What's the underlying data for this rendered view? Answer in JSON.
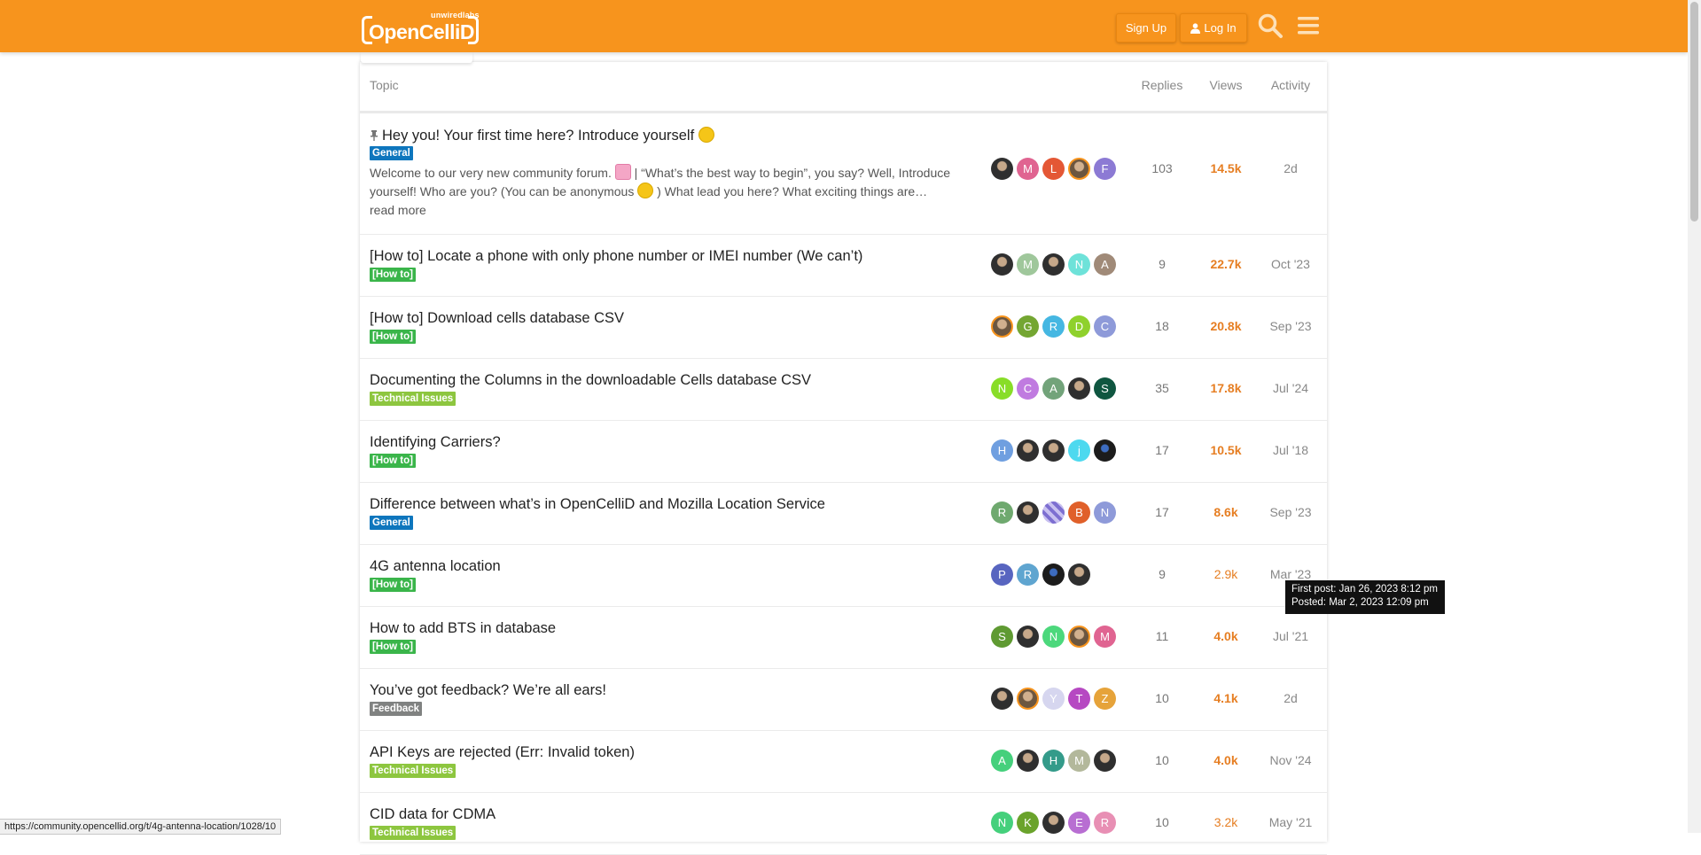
{
  "header": {
    "brand_small": "unwiredlabs",
    "brand": "OpenCelliD",
    "signup_label": "Sign Up",
    "login_label": "Log In",
    "bg": "#f7941d"
  },
  "table": {
    "col_topic": "Topic",
    "col_replies": "Replies",
    "col_views": "Views",
    "col_activity": "Activity"
  },
  "topics": [
    {
      "title": "Hey you! Your first time here? Introduce yourself",
      "pinned": true,
      "category": "General",
      "category_color": "#0e76bd",
      "excerpt_1": "Welcome to our very new community forum.",
      "excerpt_2": "| “What’s the best way to begin”, you say? Well, Introduce yourself! Who are you? (You can be anonymous",
      "excerpt_3": ") What lead you here? What exciting things are…",
      "read_more": "read more",
      "posters": [
        {
          "letter": "",
          "color": "",
          "kind": "photo"
        },
        {
          "letter": "M",
          "color": "#e06491"
        },
        {
          "letter": "L",
          "color": "#e45735"
        },
        {
          "letter": "",
          "color": "",
          "kind": "photo alt"
        },
        {
          "letter": "F",
          "color": "#8c7ad4"
        }
      ],
      "replies": "103",
      "views": "14.5k",
      "activity": "2d"
    },
    {
      "title": "[How to] Locate a phone with only phone number or IMEI number (We can’t)",
      "category": "[How to]",
      "category_color": "#3ab54a",
      "posters": [
        {
          "letter": "",
          "kind": "photo"
        },
        {
          "letter": "M",
          "color": "#9fc79b"
        },
        {
          "letter": "",
          "kind": "photo"
        },
        {
          "letter": "N",
          "color": "#6ee2d9"
        },
        {
          "letter": "A",
          "color": "#a08a78"
        }
      ],
      "replies": "9",
      "views": "22.7k",
      "activity": "Oct '23"
    },
    {
      "title": "[How to] Download cells database CSV",
      "category": "[How to]",
      "category_color": "#3ab54a",
      "posters": [
        {
          "letter": "",
          "kind": "photo alt"
        },
        {
          "letter": "G",
          "color": "#74a632"
        },
        {
          "letter": "R",
          "color": "#45b7e2"
        },
        {
          "letter": "D",
          "color": "#8fd12c"
        },
        {
          "letter": "C",
          "color": "#8e9ad9"
        }
      ],
      "replies": "18",
      "views": "20.8k",
      "activity": "Sep '23"
    },
    {
      "title": "Documenting the Columns in the downloadable Cells database CSV",
      "category": "Technical Issues",
      "category_color": "#8dc63f",
      "posters": [
        {
          "letter": "N",
          "color": "#88dd28"
        },
        {
          "letter": "C",
          "color": "#c07be0"
        },
        {
          "letter": "A",
          "color": "#72a37a"
        },
        {
          "letter": "",
          "kind": "photo"
        },
        {
          "letter": "S",
          "color": "#0f5640"
        }
      ],
      "replies": "35",
      "views": "17.8k",
      "activity": "Jul '24"
    },
    {
      "title": "Identifying Carriers?",
      "category": "[How to]",
      "category_color": "#3ab54a",
      "posters": [
        {
          "letter": "H",
          "color": "#6f9fe0"
        },
        {
          "letter": "",
          "kind": "photo"
        },
        {
          "letter": "",
          "kind": "photo"
        },
        {
          "letter": "j",
          "color": "#4dd9ef"
        },
        {
          "letter": "",
          "kind": "photo dark"
        }
      ],
      "replies": "17",
      "views": "10.5k",
      "activity": "Jul '18"
    },
    {
      "title": "Difference between what’s in OpenCelliD and Mozilla Location Service",
      "category": "General",
      "category_color": "#0e76bd",
      "posters": [
        {
          "letter": "R",
          "color": "#6fa96f"
        },
        {
          "letter": "",
          "kind": "photo"
        },
        {
          "letter": "",
          "kind": "photo grid"
        },
        {
          "letter": "B",
          "color": "#e0602a"
        },
        {
          "letter": "N",
          "color": "#8e9ad9"
        }
      ],
      "replies": "17",
      "views": "8.6k",
      "activity": "Sep '23"
    },
    {
      "title": "4G antenna location",
      "category": "[How to]",
      "category_color": "#3ab54a",
      "posters": [
        {
          "letter": "P",
          "color": "#5865c0"
        },
        {
          "letter": "R",
          "color": "#5fa5d0"
        },
        {
          "letter": "",
          "kind": "photo dark"
        },
        {
          "letter": "",
          "kind": "photo"
        }
      ],
      "replies": "9",
      "views": "2.9k",
      "activity": "Mar '23",
      "views_light": true
    },
    {
      "title": "How to add BTS in database",
      "category": "[How to]",
      "category_color": "#3ab54a",
      "posters": [
        {
          "letter": "S",
          "color": "#5f9a32"
        },
        {
          "letter": "",
          "kind": "photo"
        },
        {
          "letter": "N",
          "color": "#4cd87c"
        },
        {
          "letter": "",
          "kind": "photo alt"
        },
        {
          "letter": "M",
          "color": "#e06491"
        }
      ],
      "replies": "11",
      "views": "4.0k",
      "activity": "Jul '21"
    },
    {
      "title": "You’ve got feedback? We’re all ears!",
      "category": "Feedback",
      "category_color": "#808281",
      "posters": [
        {
          "letter": "",
          "kind": "photo"
        },
        {
          "letter": "",
          "kind": "photo alt"
        },
        {
          "letter": "Y",
          "color": "#d6d6ef"
        },
        {
          "letter": "T",
          "color": "#b648c2"
        },
        {
          "letter": "Z",
          "color": "#e6a33a"
        }
      ],
      "replies": "10",
      "views": "4.1k",
      "activity": "2d"
    },
    {
      "title": "API Keys are rejected (Err: Invalid token)",
      "category": "Technical Issues",
      "category_color": "#8dc63f",
      "posters": [
        {
          "letter": "A",
          "color": "#45d07c"
        },
        {
          "letter": "",
          "kind": "photo"
        },
        {
          "letter": "H",
          "color": "#349b8a"
        },
        {
          "letter": "M",
          "color": "#b3b89b"
        },
        {
          "letter": "",
          "kind": "photo"
        }
      ],
      "replies": "10",
      "views": "4.0k",
      "activity": "Nov '24"
    },
    {
      "title": "CID data for CDMA",
      "category": "Technical Issues",
      "category_color": "#8dc63f",
      "posters": [
        {
          "letter": "N",
          "color": "#45d07c"
        },
        {
          "letter": "K",
          "color": "#6aa32c"
        },
        {
          "letter": "",
          "kind": "photo"
        },
        {
          "letter": "E",
          "color": "#b86ed2"
        },
        {
          "letter": "R",
          "color": "#e88fb4"
        }
      ],
      "replies": "10",
      "views": "3.2k",
      "activity": "May '21",
      "views_light": true
    }
  ],
  "tooltip": {
    "line1": "First post: Jan 26, 2023 8:12 pm",
    "line2": "Posted: Mar 2, 2023 12:09 pm"
  },
  "status_url": "https://community.opencellid.org/t/4g-antenna-location/1028/10"
}
